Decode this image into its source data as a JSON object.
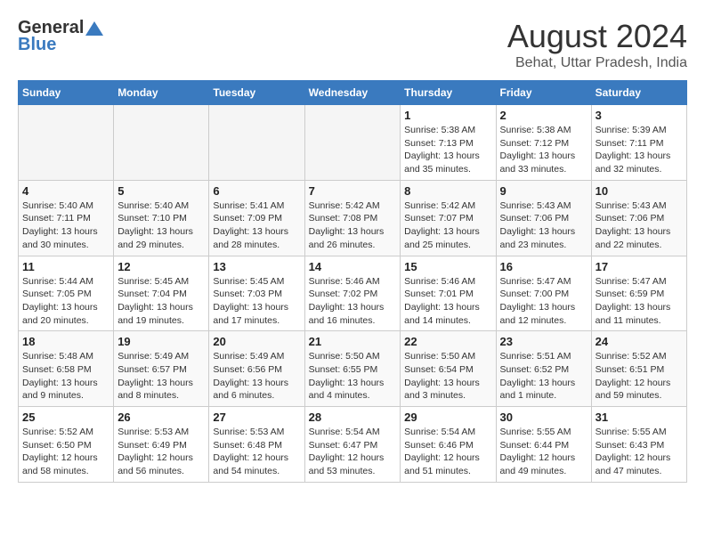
{
  "logo": {
    "general": "General",
    "blue": "Blue"
  },
  "title": "August 2024",
  "location": "Behat, Uttar Pradesh, India",
  "days_of_week": [
    "Sunday",
    "Monday",
    "Tuesday",
    "Wednesday",
    "Thursday",
    "Friday",
    "Saturday"
  ],
  "weeks": [
    [
      {
        "day": "",
        "info": ""
      },
      {
        "day": "",
        "info": ""
      },
      {
        "day": "",
        "info": ""
      },
      {
        "day": "",
        "info": ""
      },
      {
        "day": "1",
        "info": "Sunrise: 5:38 AM\nSunset: 7:13 PM\nDaylight: 13 hours\nand 35 minutes."
      },
      {
        "day": "2",
        "info": "Sunrise: 5:38 AM\nSunset: 7:12 PM\nDaylight: 13 hours\nand 33 minutes."
      },
      {
        "day": "3",
        "info": "Sunrise: 5:39 AM\nSunset: 7:11 PM\nDaylight: 13 hours\nand 32 minutes."
      }
    ],
    [
      {
        "day": "4",
        "info": "Sunrise: 5:40 AM\nSunset: 7:11 PM\nDaylight: 13 hours\nand 30 minutes."
      },
      {
        "day": "5",
        "info": "Sunrise: 5:40 AM\nSunset: 7:10 PM\nDaylight: 13 hours\nand 29 minutes."
      },
      {
        "day": "6",
        "info": "Sunrise: 5:41 AM\nSunset: 7:09 PM\nDaylight: 13 hours\nand 28 minutes."
      },
      {
        "day": "7",
        "info": "Sunrise: 5:42 AM\nSunset: 7:08 PM\nDaylight: 13 hours\nand 26 minutes."
      },
      {
        "day": "8",
        "info": "Sunrise: 5:42 AM\nSunset: 7:07 PM\nDaylight: 13 hours\nand 25 minutes."
      },
      {
        "day": "9",
        "info": "Sunrise: 5:43 AM\nSunset: 7:06 PM\nDaylight: 13 hours\nand 23 minutes."
      },
      {
        "day": "10",
        "info": "Sunrise: 5:43 AM\nSunset: 7:06 PM\nDaylight: 13 hours\nand 22 minutes."
      }
    ],
    [
      {
        "day": "11",
        "info": "Sunrise: 5:44 AM\nSunset: 7:05 PM\nDaylight: 13 hours\nand 20 minutes."
      },
      {
        "day": "12",
        "info": "Sunrise: 5:45 AM\nSunset: 7:04 PM\nDaylight: 13 hours\nand 19 minutes."
      },
      {
        "day": "13",
        "info": "Sunrise: 5:45 AM\nSunset: 7:03 PM\nDaylight: 13 hours\nand 17 minutes."
      },
      {
        "day": "14",
        "info": "Sunrise: 5:46 AM\nSunset: 7:02 PM\nDaylight: 13 hours\nand 16 minutes."
      },
      {
        "day": "15",
        "info": "Sunrise: 5:46 AM\nSunset: 7:01 PM\nDaylight: 13 hours\nand 14 minutes."
      },
      {
        "day": "16",
        "info": "Sunrise: 5:47 AM\nSunset: 7:00 PM\nDaylight: 13 hours\nand 12 minutes."
      },
      {
        "day": "17",
        "info": "Sunrise: 5:47 AM\nSunset: 6:59 PM\nDaylight: 13 hours\nand 11 minutes."
      }
    ],
    [
      {
        "day": "18",
        "info": "Sunrise: 5:48 AM\nSunset: 6:58 PM\nDaylight: 13 hours\nand 9 minutes."
      },
      {
        "day": "19",
        "info": "Sunrise: 5:49 AM\nSunset: 6:57 PM\nDaylight: 13 hours\nand 8 minutes."
      },
      {
        "day": "20",
        "info": "Sunrise: 5:49 AM\nSunset: 6:56 PM\nDaylight: 13 hours\nand 6 minutes."
      },
      {
        "day": "21",
        "info": "Sunrise: 5:50 AM\nSunset: 6:55 PM\nDaylight: 13 hours\nand 4 minutes."
      },
      {
        "day": "22",
        "info": "Sunrise: 5:50 AM\nSunset: 6:54 PM\nDaylight: 13 hours\nand 3 minutes."
      },
      {
        "day": "23",
        "info": "Sunrise: 5:51 AM\nSunset: 6:52 PM\nDaylight: 13 hours\nand 1 minute."
      },
      {
        "day": "24",
        "info": "Sunrise: 5:52 AM\nSunset: 6:51 PM\nDaylight: 12 hours\nand 59 minutes."
      }
    ],
    [
      {
        "day": "25",
        "info": "Sunrise: 5:52 AM\nSunset: 6:50 PM\nDaylight: 12 hours\nand 58 minutes."
      },
      {
        "day": "26",
        "info": "Sunrise: 5:53 AM\nSunset: 6:49 PM\nDaylight: 12 hours\nand 56 minutes."
      },
      {
        "day": "27",
        "info": "Sunrise: 5:53 AM\nSunset: 6:48 PM\nDaylight: 12 hours\nand 54 minutes."
      },
      {
        "day": "28",
        "info": "Sunrise: 5:54 AM\nSunset: 6:47 PM\nDaylight: 12 hours\nand 53 minutes."
      },
      {
        "day": "29",
        "info": "Sunrise: 5:54 AM\nSunset: 6:46 PM\nDaylight: 12 hours\nand 51 minutes."
      },
      {
        "day": "30",
        "info": "Sunrise: 5:55 AM\nSunset: 6:44 PM\nDaylight: 12 hours\nand 49 minutes."
      },
      {
        "day": "31",
        "info": "Sunrise: 5:55 AM\nSunset: 6:43 PM\nDaylight: 12 hours\nand 47 minutes."
      }
    ]
  ]
}
